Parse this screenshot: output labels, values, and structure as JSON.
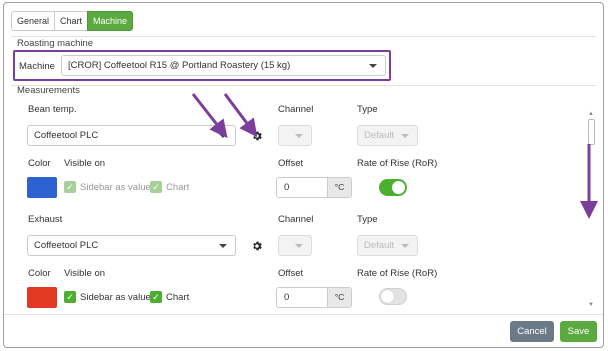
{
  "tabs": [
    {
      "label": "General",
      "active": false
    },
    {
      "label": "Chart",
      "active": false
    },
    {
      "label": "Machine",
      "active": true
    }
  ],
  "roasting": {
    "section_title": "Roasting machine",
    "machine_label": "Machine",
    "machine_value": "[CROR] Coffeetool R15 @ Portland Roastery (15 kg)"
  },
  "measurements": {
    "section_title": "Measurements",
    "rows": [
      {
        "name": "Bean temp.",
        "source": "Coffeetool PLC",
        "channel_label": "Channel",
        "type_label": "Type",
        "type_value": "Default",
        "color_label": "Color",
        "color": "#2c62d1",
        "visible_on_label": "Visible on",
        "sidebar_label": "Sidebar as value",
        "chart_label": "Chart",
        "sidebar_checked": true,
        "chart_checked": true,
        "checkbox_state": "muted",
        "offset_label": "Offset",
        "offset_value": "0",
        "offset_unit": "°C",
        "ror_label": "Rate of Rise (RoR)",
        "ror_enabled": true
      },
      {
        "name": "Exhaust",
        "source": "Coffeetool PLC",
        "channel_label": "Channel",
        "type_label": "Type",
        "type_value": "Default",
        "color_label": "Color",
        "color": "#e23a22",
        "visible_on_label": "Visible on",
        "sidebar_label": "Sidebar as value",
        "chart_label": "Chart",
        "sidebar_checked": true,
        "chart_checked": true,
        "checkbox_state": "on",
        "offset_label": "Offset",
        "offset_value": "0",
        "offset_unit": "°C",
        "ror_label": "Rate of Rise (RoR)",
        "ror_enabled": false
      }
    ]
  },
  "icons": {
    "checkmark": "✓",
    "scroll_up": "▲",
    "scroll_down": "▼"
  },
  "buttons": {
    "cancel": "Cancel",
    "save": "Save"
  },
  "colors": {
    "accent_green": "#5aaa3f",
    "annotation_purple": "#7b3f9b",
    "cancel_gray": "#6c7a86"
  }
}
